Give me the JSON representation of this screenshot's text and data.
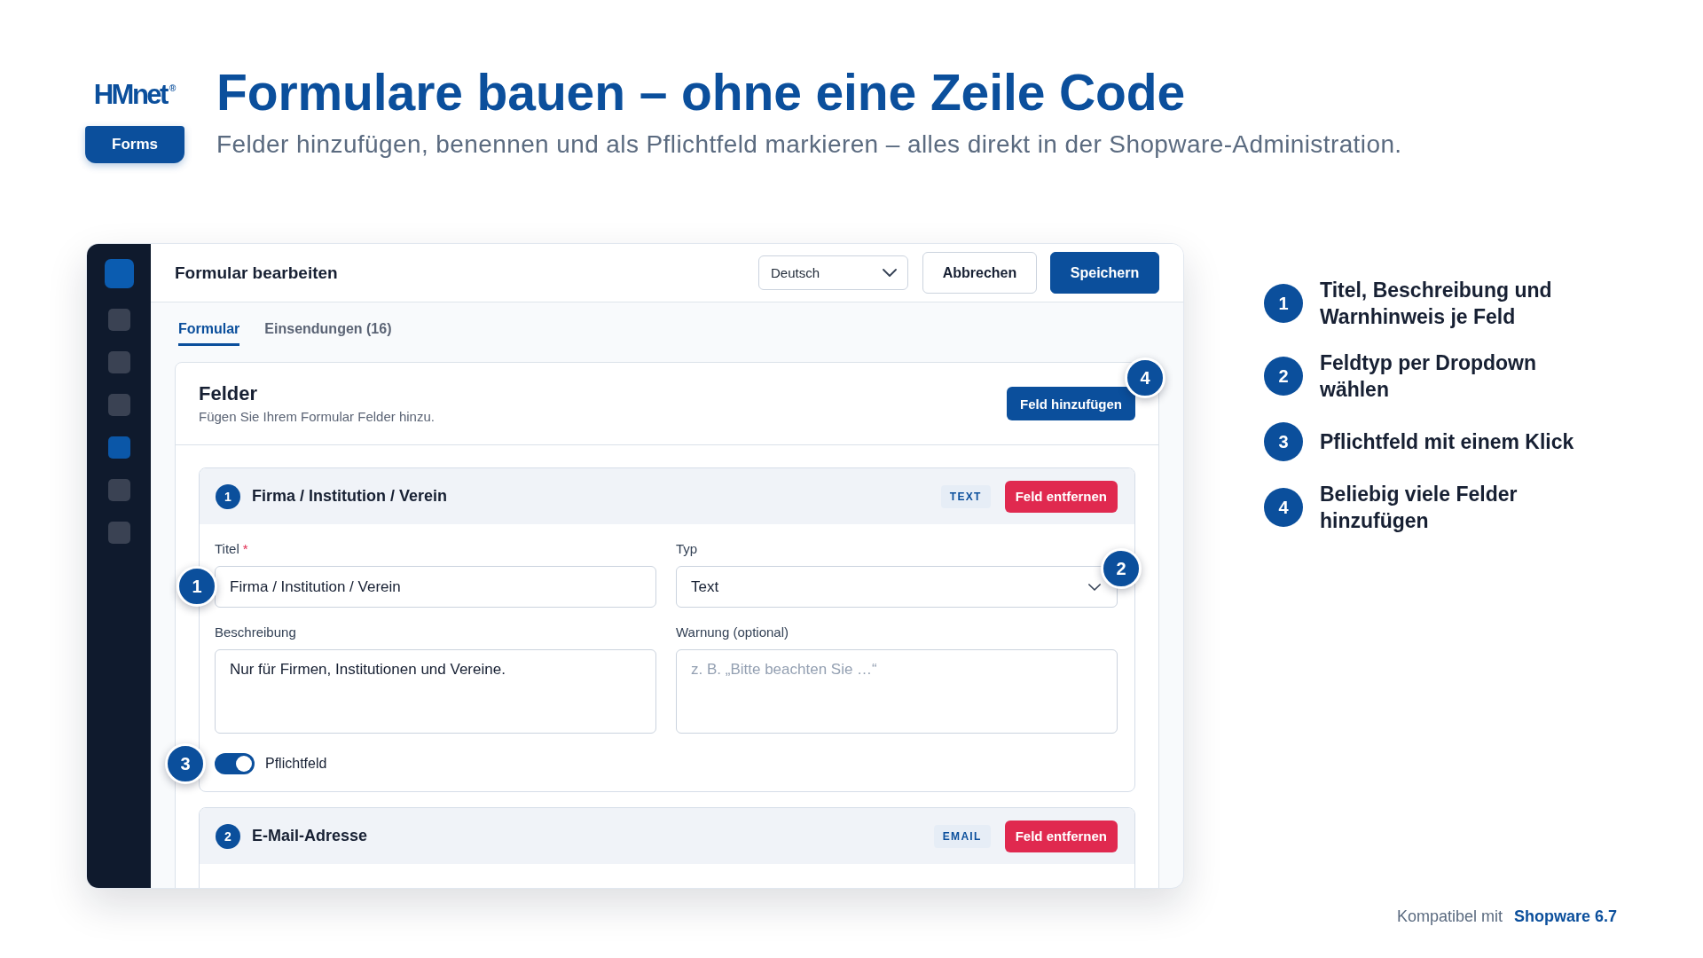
{
  "header": {
    "logo": {
      "wordmark": "HMnet$^{®}$",
      "badge": "Forms"
    },
    "title": "Formulare bauen – ohne eine Zeile Code",
    "subtitle": "Felder hinzufügen, benennen und als Pflichtfeld markieren – alles direkt in der Shopware-Administration."
  },
  "sidebar": {
    "items": [
      {
        "selected": false
      },
      {
        "selected": false
      },
      {
        "selected": false
      },
      {
        "selected": true
      },
      {
        "selected": false
      },
      {
        "selected": false
      }
    ]
  },
  "window": {
    "title": "Formular bearbeiten",
    "language_select": {
      "value": "Deutsch"
    },
    "buttons": [
      {
        "label": "Abbrechen",
        "kind": "secondary"
      },
      {
        "label": "Speichern",
        "kind": "primary"
      }
    ]
  },
  "tabs": [
    {
      "label": "Formular",
      "selected": true
    },
    {
      "label": "Einsendungen (16)",
      "selected": false
    }
  ],
  "fields_panel": {
    "title": "Felder",
    "description": "Fügen Sie Ihrem Formular Felder hinzu.",
    "add_button": {
      "label": "Feld hinzufügen",
      "callout": "4"
    }
  },
  "fields": [
    {
      "number": "1",
      "name": "Firma / Institution / Verein",
      "type_tag": "TEXT",
      "remove_button": "Feld entfernen",
      "title_field": {
        "label": "Titel",
        "required_mark": "*",
        "value": "Firma / Institution / Verein",
        "callout": "1"
      },
      "type_field": {
        "label": "Typ",
        "value": "Text",
        "callout": "2"
      },
      "description_field": {
        "label": "Beschreibung",
        "value": "Nur für Firmen, Institutionen und Vereine."
      },
      "warning_field": {
        "label": "Warnung (optional)",
        "placeholder": "z. B. „Bitte beachten Sie …“"
      },
      "required_toggle": {
        "label": "Pflichtfeld",
        "on": true,
        "callout": "3"
      }
    },
    {
      "number": "2",
      "name": "E-Mail-Adresse",
      "type_tag": "EMAIL",
      "remove_button": "Feld entfernen"
    }
  ],
  "features": [
    {
      "number": "1",
      "text": "Titel, Beschreibung und Warnhinweis je Feld"
    },
    {
      "number": "2",
      "text": "Feldtyp per Dropdown wählen"
    },
    {
      "number": "3",
      "text": "Pflichtfeld mit einem Klick"
    },
    {
      "number": "4",
      "text": "Beliebig viele Felder hinzufügen"
    }
  ],
  "footer": {
    "label": "Kompatibel mit",
    "product": "Shopware 6.7"
  }
}
